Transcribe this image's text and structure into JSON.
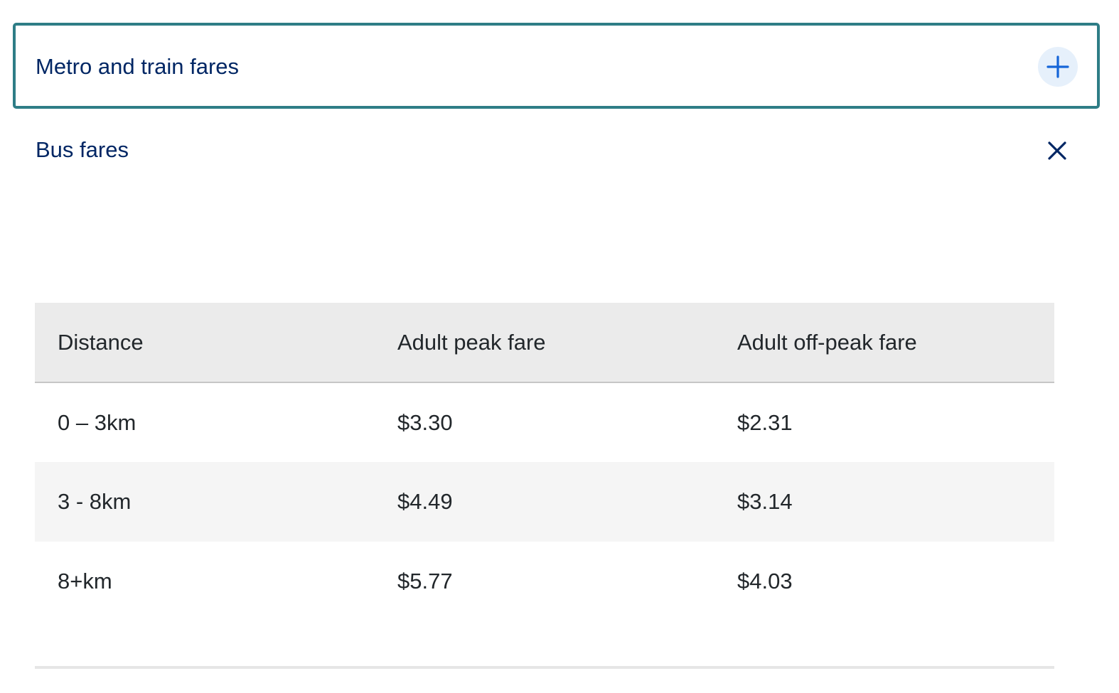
{
  "accordion": {
    "metro": {
      "title": "Metro and train fares",
      "state": "collapsed",
      "toggle_icon": "plus-icon"
    },
    "bus": {
      "title": "Bus fares",
      "state": "expanded",
      "toggle_icon": "close-icon"
    }
  },
  "bus_fares_table": {
    "headers": [
      "Distance",
      "Adult peak fare",
      "Adult off-peak fare"
    ],
    "rows": [
      [
        "0 – 3km",
        "$3.30",
        "$2.31"
      ],
      [
        "3 - 8km",
        "$4.49",
        "$3.14"
      ],
      [
        "8+km",
        "$5.77",
        "$4.03"
      ]
    ]
  },
  "colors": {
    "accent_border": "#2e7d86",
    "title_text": "#002664",
    "icon_blue": "#1565d8",
    "header_bg": "#ebebeb",
    "stripe_bg": "#f5f5f5"
  }
}
